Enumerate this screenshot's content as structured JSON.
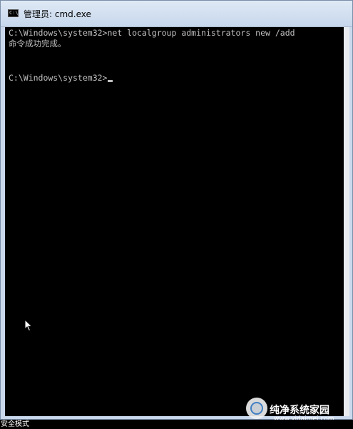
{
  "window": {
    "title": "管理员: cmd.exe",
    "icon": "console-icon"
  },
  "console": {
    "lines": [
      "C:\\Windows\\system32>net localgroup administrators new /add",
      "命令成功完成。",
      "C:\\Windows\\system32>"
    ],
    "text_color": "#c0c0c0",
    "background": "#000000"
  },
  "status_bar": {
    "text": "安全模式"
  },
  "watermark": {
    "site_name": "纯净系统家园",
    "site_url": "www.yidaimei.com",
    "icon": "site-logo-icon"
  }
}
